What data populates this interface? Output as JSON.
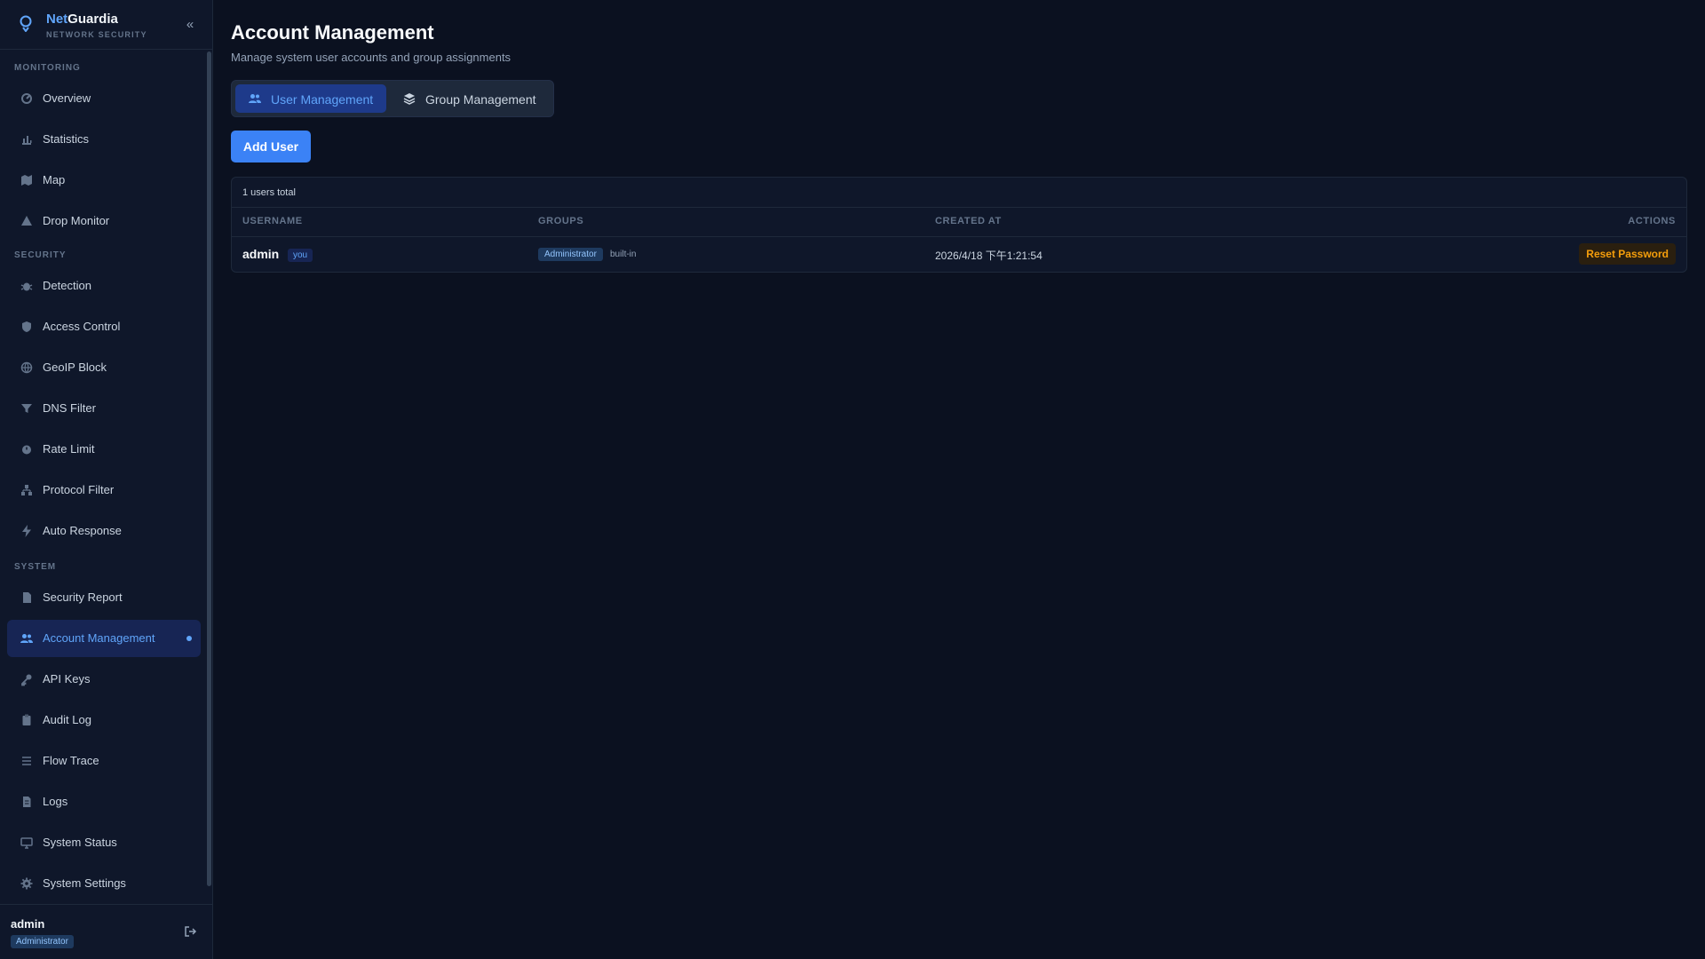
{
  "brand": {
    "name_accent": "Net",
    "name_rest": "Guardia",
    "subtitle": "NETWORK SECURITY",
    "collapse_icon": "chevrons-left-icon"
  },
  "sidebar": {
    "sections": [
      {
        "title": "MONITORING",
        "items": [
          {
            "label": "Overview",
            "icon": "gauge-icon"
          },
          {
            "label": "Statistics",
            "icon": "bar-chart-icon"
          },
          {
            "label": "Map",
            "icon": "map-icon"
          },
          {
            "label": "Drop Monitor",
            "icon": "warning-icon"
          }
        ]
      },
      {
        "title": "SECURITY",
        "items": [
          {
            "label": "Detection",
            "icon": "bug-icon"
          },
          {
            "label": "Access Control",
            "icon": "shield-icon"
          },
          {
            "label": "GeoIP Block",
            "icon": "globe-icon"
          },
          {
            "label": "DNS Filter",
            "icon": "filter-icon"
          },
          {
            "label": "Rate Limit",
            "icon": "timer-icon"
          },
          {
            "label": "Protocol Filter",
            "icon": "network-icon"
          },
          {
            "label": "Auto Response",
            "icon": "bolt-icon"
          }
        ]
      },
      {
        "title": "SYSTEM",
        "items": [
          {
            "label": "Security Report",
            "icon": "file-icon"
          },
          {
            "label": "Account Management",
            "icon": "users-icon",
            "active": true
          },
          {
            "label": "API Keys",
            "icon": "key-icon"
          },
          {
            "label": "Audit Log",
            "icon": "clipboard-icon"
          },
          {
            "label": "Flow Trace",
            "icon": "list-icon"
          },
          {
            "label": "Logs",
            "icon": "document-icon"
          },
          {
            "label": "System Status",
            "icon": "monitor-icon"
          },
          {
            "label": "System Settings",
            "icon": "gear-icon"
          }
        ]
      }
    ]
  },
  "user": {
    "name": "admin",
    "role": "Administrator",
    "logout_icon": "logout-icon"
  },
  "page": {
    "title": "Account Management",
    "subtitle": "Manage system user accounts and group assignments"
  },
  "tabs": [
    {
      "label": "User Management",
      "icon": "users-icon",
      "active": true
    },
    {
      "label": "Group Management",
      "icon": "layers-icon",
      "active": false
    }
  ],
  "actions": {
    "add_user": "Add User"
  },
  "table": {
    "summary": "1 users total",
    "columns": {
      "username": "USERNAME",
      "groups": "GROUPS",
      "created_at": "CREATED AT",
      "actions": "ACTIONS"
    },
    "rows": [
      {
        "username": "admin",
        "self_badge": "you",
        "group": "Administrator",
        "group_tag": "built-in",
        "created_at": "2026/4/18 下午1:21:54",
        "action": "Reset Password"
      }
    ]
  },
  "colors": {
    "accent": "#3b82f6",
    "active_text": "#60a5fa",
    "warning": "#f59e0b",
    "background": "#0b1120",
    "sidebar": "#0f172a"
  }
}
